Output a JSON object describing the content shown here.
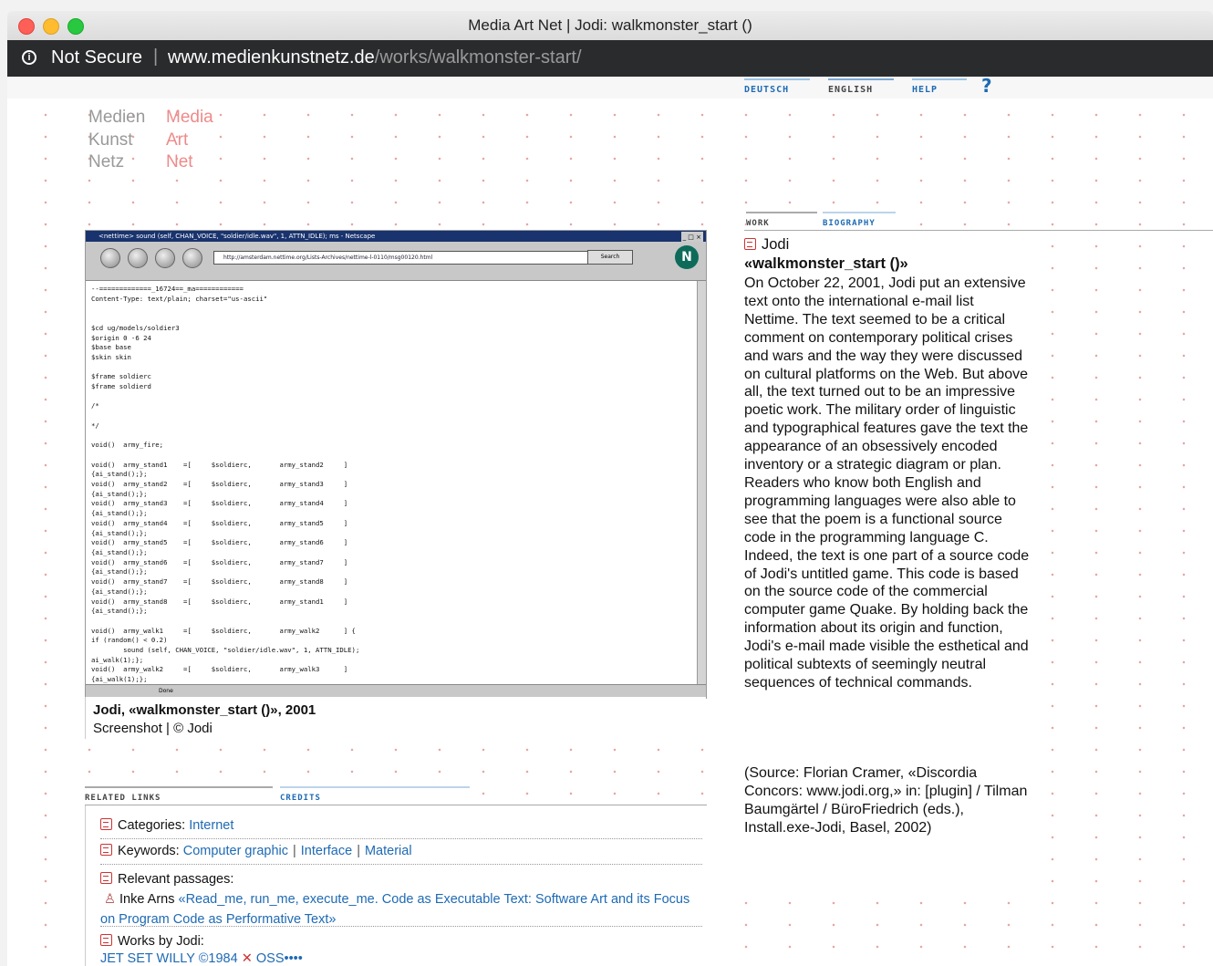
{
  "window": {
    "title": "Media Art Net | Jodi: walkmonster_start ()"
  },
  "urlbar": {
    "security": "Not Secure",
    "separator": "|",
    "domain": "www.medienkunstnetz.de",
    "path": "/works/walkmonster-start/"
  },
  "langnav": {
    "deutsch": "DEUTSCH",
    "english": "ENGLISH",
    "help": "HELP",
    "help_icon": "?"
  },
  "logo": {
    "de": [
      "Medien",
      "Kunst",
      "Netz"
    ],
    "en": [
      "Media",
      "Art",
      "Net"
    ]
  },
  "screenshot": {
    "titlebar": "<nettime> sound (self, CHAN_VOICE, \"soldier/idle.wav\", 1, ATTN_IDLE); ms - Netscape",
    "address": "http://amsterdam.nettime.org/Lists-Archives/nettime-l-0110/msg00120.html",
    "search_label": "Search",
    "status": "Done",
    "code": "--=============_16724==_ma============\nContent-Type: text/plain; charset=\"us-ascii\"\n\n\n$cd ug/models/soldier3\n$origin 0 -6 24\n$base base\n$skin skin\n\n$frame soldierc\n$frame soldierd\n\n/*\n\n*/\n\nvoid()  army_fire;\n\nvoid()  army_stand1    =[     $soldierc,       army_stand2     ]\n{ai_stand();};\nvoid()  army_stand2    =[     $soldierc,       army_stand3     ]\n{ai_stand();};\nvoid()  army_stand3    =[     $soldierc,       army_stand4     ]\n{ai_stand();};\nvoid()  army_stand4    =[     $soldierc,       army_stand5     ]\n{ai_stand();};\nvoid()  army_stand5    =[     $soldierc,       army_stand6     ]\n{ai_stand();};\nvoid()  army_stand6    =[     $soldierc,       army_stand7     ]\n{ai_stand();};\nvoid()  army_stand7    =[     $soldierc,       army_stand8     ]\n{ai_stand();};\nvoid()  army_stand8    =[     $soldierc,       army_stand1     ]\n{ai_stand();};\n\nvoid()  army_walk1     =[     $soldierc,       army_walk2      ] {\nif (random() < 0.2)\n        sound (self, CHAN_VOICE, \"soldier/idle.wav\", 1, ATTN_IDLE);\nai_walk(1);};\nvoid()  army_walk2     =[     $soldierc,       army_walk3      ]\n{ai_walk(1);};"
  },
  "caption": {
    "title": "Jodi, «walkmonster_start ()», 2001",
    "subtitle": "Screenshot | © Jodi"
  },
  "related_tabs": {
    "related_links": "RELATED LINKS",
    "credits": "CREDITS"
  },
  "related": {
    "categories_label": "Categories:",
    "categories": [
      "Internet"
    ],
    "keywords_label": "Keywords:",
    "keywords": [
      "Computer graphic",
      "Interface",
      "Material"
    ],
    "passages_label": "Relevant passages:",
    "passage_author": "Inke Arns",
    "passage_text": "«Read_me, run_me, execute_me. Code as Executable Text: Software Art and its Focus on Program Code as Performative Text»",
    "works_label": "Works by Jodi:",
    "works": [
      "JET SET WILLY ©1984",
      "OSS••••"
    ]
  },
  "work_tabs": {
    "work": "WORK",
    "biography": "BIOGRAPHY"
  },
  "article": {
    "artist": "Jodi",
    "title": "«walkmonster_start ()»",
    "body": "On October 22, 2001, Jodi put an extensive text onto the international e-mail list Nettime. The text seemed to be a critical comment on contemporary political crises and wars and the way they were discussed on cultural platforms on the Web. But above all, the text turned out to be an impressive poetic work. The military order of linguistic and typographical features gave the text the appearance of an obsessively encoded inventory or a strategic diagram or plan. Readers who know both English and programming languages were also able to see that the poem is a functional source code in the programming language C. Indeed, the text is one part of a source code of Jodi's untitled game. This code is based on the source code of the commercial computer game Quake. By holding back the information about its origin and function, Jodi's e-mail made visible the esthetical and political subtexts of seemingly neutral sequences of technical commands.",
    "source": "(Source: Florian Cramer, «Discordia Concors: www.jodi.org,» in: [plugin] / Tilman Baumgärtel / BüroFriedrich (eds.), Install.exe-Jodi, Basel, 2002)"
  },
  "colors": {
    "link": "#1e6ab4",
    "accent_pink": "#ee8a8a",
    "urlbar_bg": "#2a2b2d"
  }
}
